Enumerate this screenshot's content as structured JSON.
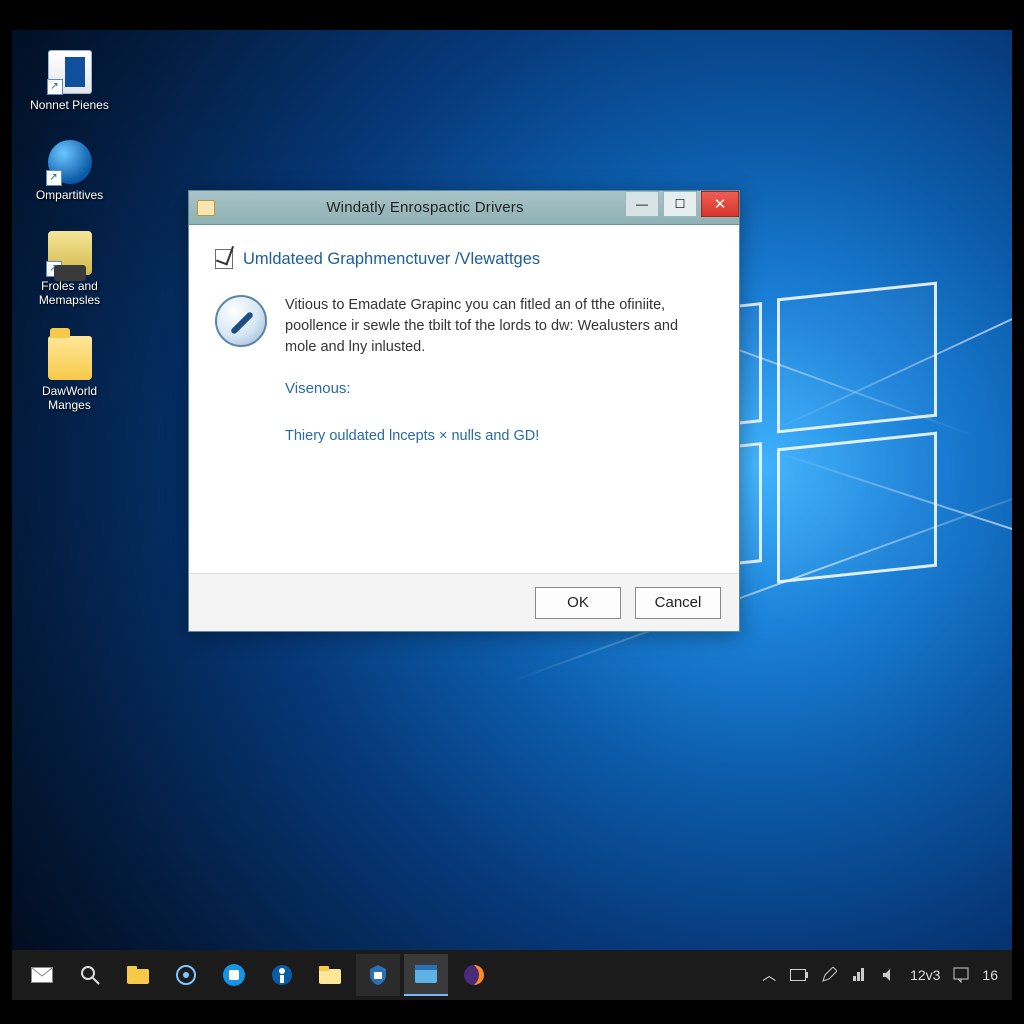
{
  "desktop": {
    "icons": [
      {
        "label": "Nonnet Pienes"
      },
      {
        "label": "Ompartitives"
      },
      {
        "label": "Froles and Memapsles"
      },
      {
        "label": "DawWorld Manges"
      }
    ]
  },
  "dialog": {
    "title": "Windatly Enrospactic Drivers",
    "heading": "Umldateed Graphmenctuver /Vlewattges",
    "body": "Vitious to Emadate Grapinc you can fitled an of tthe ofiniite, poollence ir sewle the tbilt tof the lords to dw: Wealusters and mole and lny inlusted.",
    "sub1": "Visenous:",
    "sub2": "Thiery ouldated lncepts × nulls and GD!",
    "ok_label": "OK",
    "cancel_label": "Cancel"
  },
  "taskbar": {
    "tray": {
      "time": "12v3",
      "extra": "16"
    }
  }
}
